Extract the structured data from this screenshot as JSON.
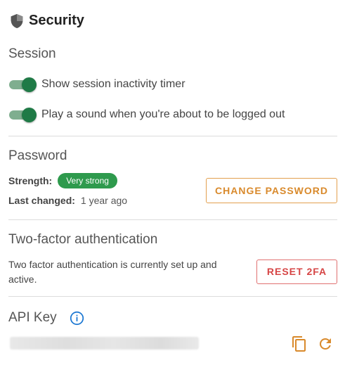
{
  "header": {
    "title": "Security",
    "icon": "shield-icon"
  },
  "session": {
    "title": "Session",
    "toggles": [
      {
        "label": "Show session inactivity timer",
        "on": true
      },
      {
        "label": "Play a sound when you're about to be logged out",
        "on": true
      }
    ]
  },
  "password": {
    "title": "Password",
    "strength_label": "Strength:",
    "strength_value": "Very strong",
    "last_changed_label": "Last changed:",
    "last_changed_value": "1 year ago",
    "change_button": "CHANGE PASSWORD"
  },
  "two_factor": {
    "title": "Two-factor authentication",
    "description": "Two factor authentication is currently set up and active.",
    "reset_button": "RESET 2FA"
  },
  "api_key": {
    "title": "API Key",
    "info_icon": "info-icon",
    "copy_icon": "copy-icon",
    "refresh_icon": "refresh-icon"
  },
  "colors": {
    "accent_orange": "#d98a2c",
    "danger_red": "#d64545",
    "success_green": "#2e9a4d",
    "toggle_on": "#1f7a46",
    "info_blue": "#1976d2"
  }
}
